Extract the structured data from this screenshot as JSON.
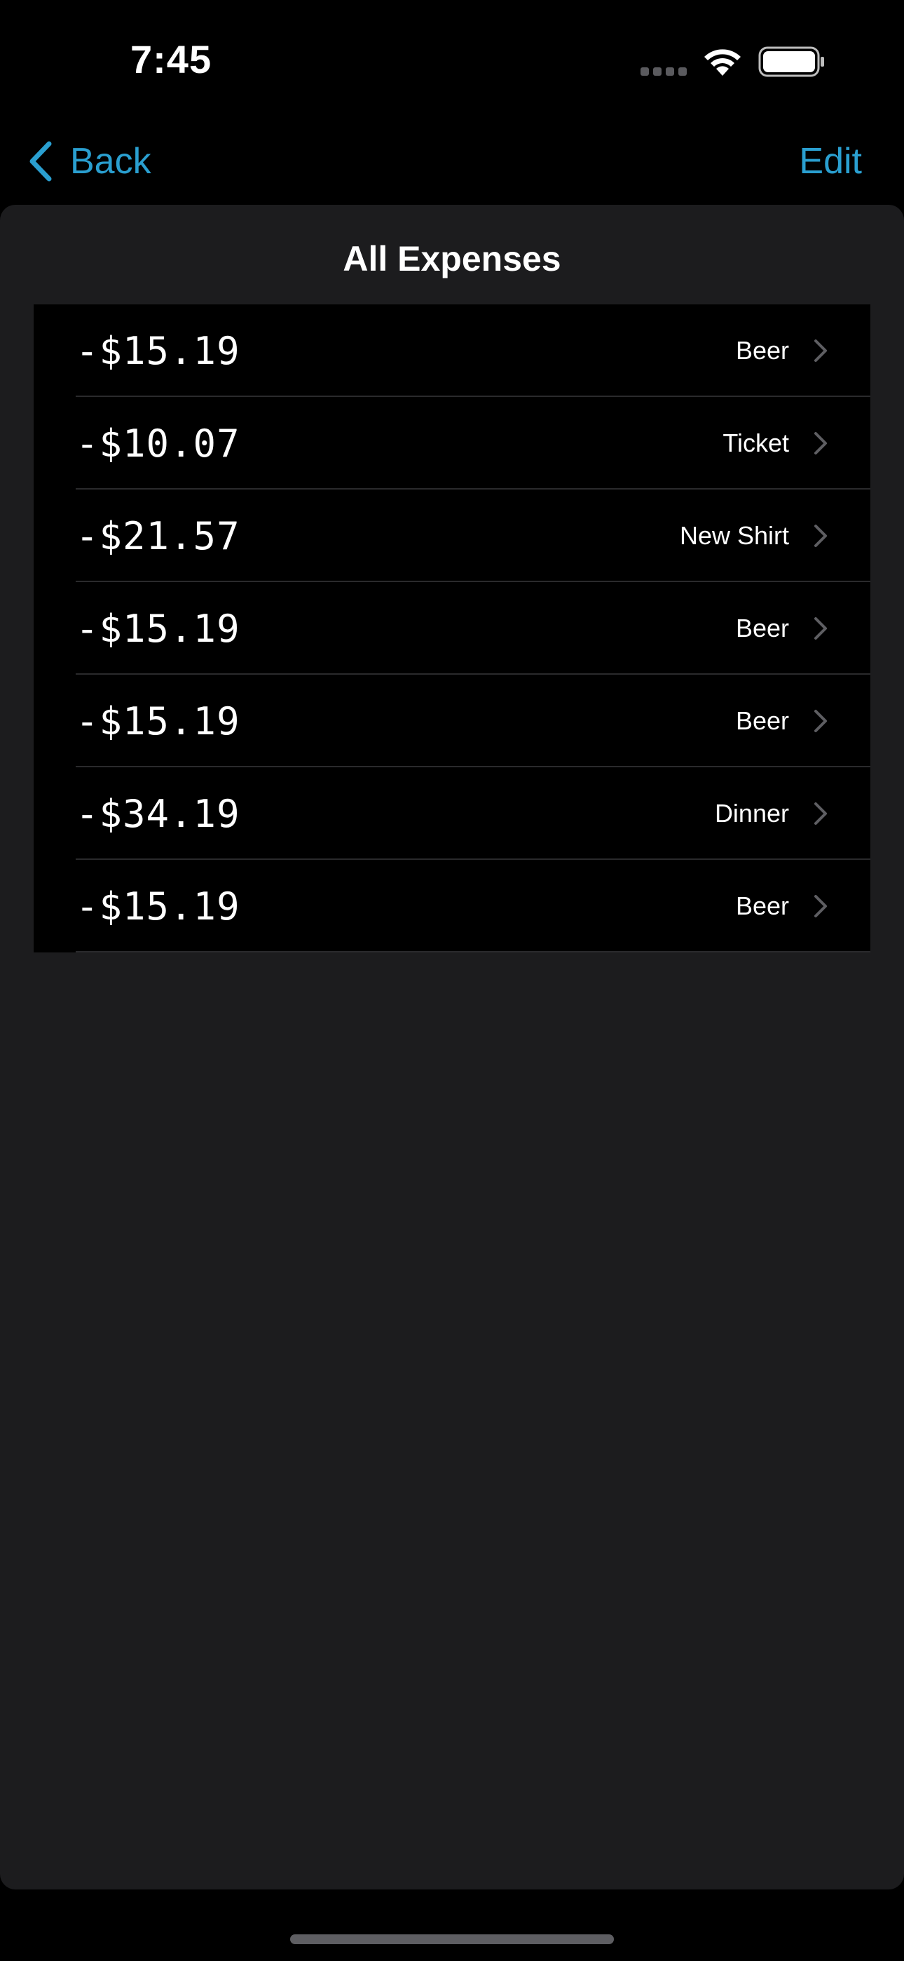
{
  "status_bar": {
    "time": "7:45"
  },
  "nav": {
    "back_label": "Back",
    "edit_label": "Edit",
    "accent_color": "#2a9fd0"
  },
  "sheet": {
    "title": "All Expenses",
    "background": "#1c1c1e"
  },
  "expenses": [
    {
      "amount": "-$15.19",
      "category": "Beer"
    },
    {
      "amount": "-$10.07",
      "category": "Ticket"
    },
    {
      "amount": "-$21.57",
      "category": "New Shirt"
    },
    {
      "amount": "-$15.19",
      "category": "Beer"
    },
    {
      "amount": "-$15.19",
      "category": "Beer"
    },
    {
      "amount": "-$34.19",
      "category": "Dinner"
    },
    {
      "amount": "-$15.19",
      "category": "Beer"
    }
  ],
  "icons": {
    "back": "chevron-left-icon",
    "row_disclosure": "chevron-right-icon",
    "wifi": "wifi-icon",
    "battery": "battery-icon",
    "signal": "cellular-signal-icon"
  }
}
